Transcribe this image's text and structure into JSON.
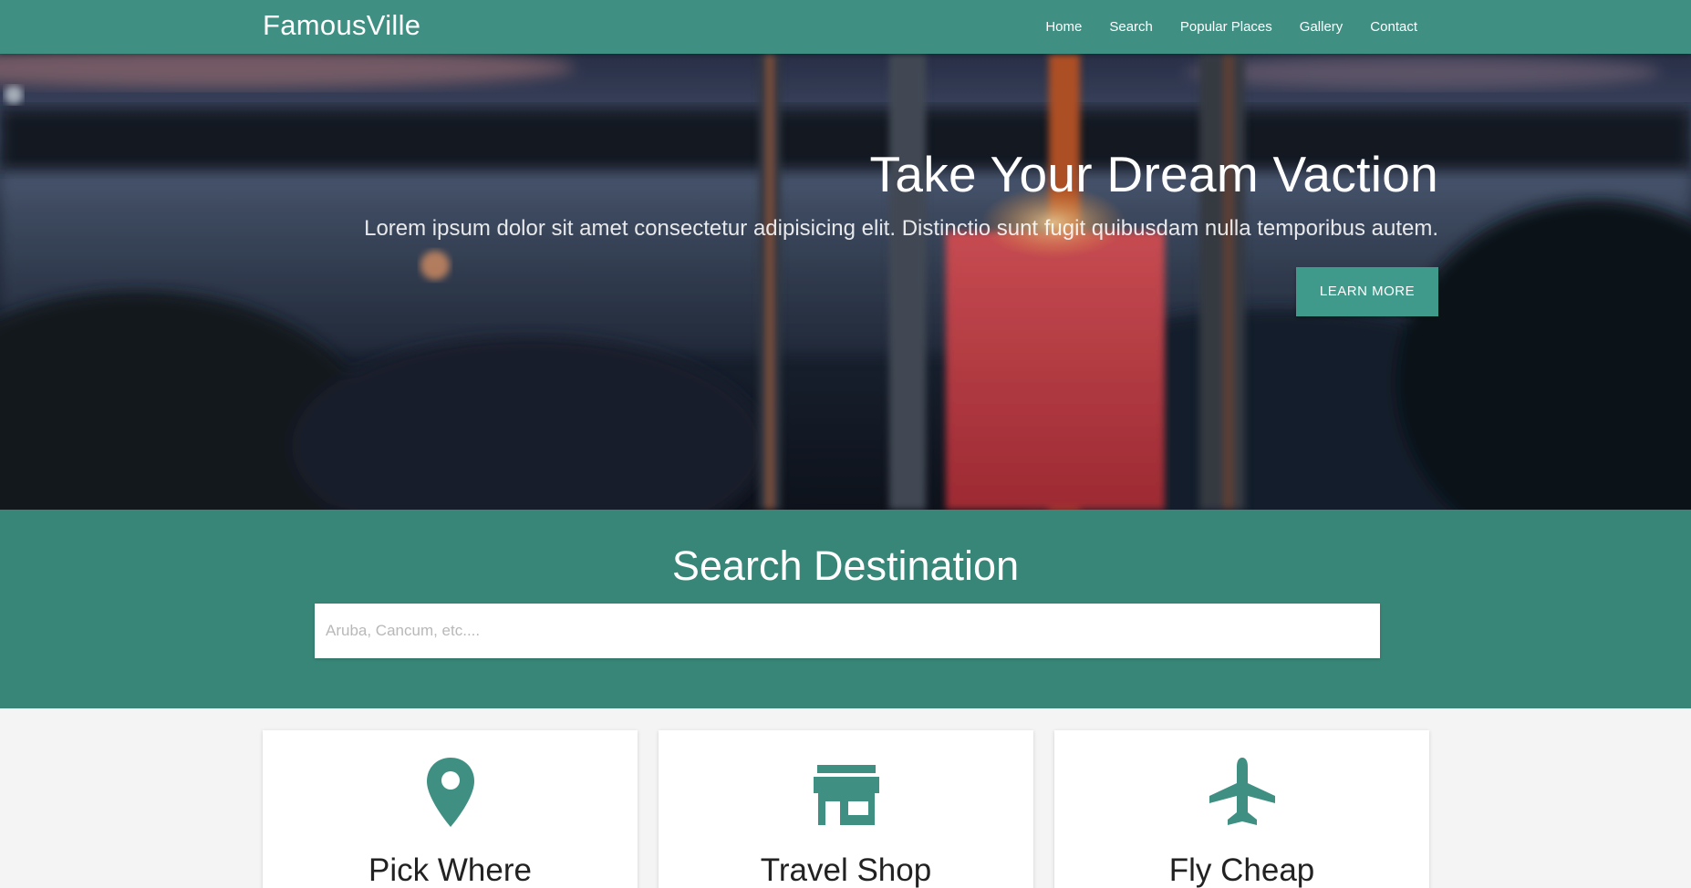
{
  "navbar": {
    "brand": "FamousVille",
    "links": [
      "Home",
      "Search",
      "Popular Places",
      "Gallery",
      "Contact"
    ]
  },
  "hero": {
    "title": "Take Your Dream Vaction",
    "subtitle": "Lorem ipsum dolor sit amet consectetur adipisicing elit. Distinctio sunt fugit quibusdam nulla temporibus autem.",
    "button_label": "LEARN MORE"
  },
  "search": {
    "title": "Search Destination",
    "placeholder": "Aruba, Cancum, etc...."
  },
  "cards": [
    {
      "icon": "map-pin-icon",
      "title": "Pick Where"
    },
    {
      "icon": "store-icon",
      "title": "Travel Shop"
    },
    {
      "icon": "airplane-icon",
      "title": "Fly Cheap"
    }
  ],
  "colors": {
    "primary": "#3f9083",
    "search_band": "#388677",
    "button": "#3f9a8b",
    "icon": "#3f9083",
    "page_bg": "#f4f4f4"
  }
}
